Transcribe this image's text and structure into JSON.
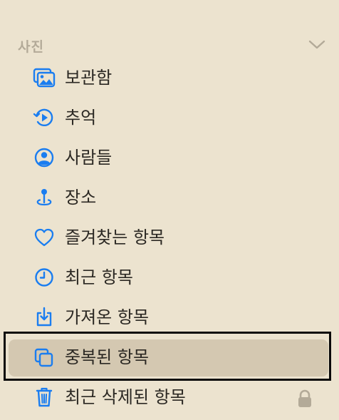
{
  "section": {
    "title": "사진"
  },
  "items": [
    {
      "label": "보관함",
      "icon": "photo-library-icon"
    },
    {
      "label": "추억",
      "icon": "memories-icon"
    },
    {
      "label": "사람들",
      "icon": "people-icon"
    },
    {
      "label": "장소",
      "icon": "map-pin-icon"
    },
    {
      "label": "즐겨찾는 항목",
      "icon": "heart-icon"
    },
    {
      "label": "최근 항목",
      "icon": "clock-icon"
    },
    {
      "label": "가져온 항목",
      "icon": "import-icon"
    },
    {
      "label": "중복된 항목",
      "icon": "duplicate-icon",
      "selected": true
    },
    {
      "label": "최근 삭제된 항목",
      "icon": "trash-icon",
      "locked": true
    }
  ],
  "colors": {
    "background": "#ece3cf",
    "accent": "#1a7df0",
    "selected": "#d4c8b1",
    "text": "#2b2823",
    "muted": "#b3aa98"
  }
}
